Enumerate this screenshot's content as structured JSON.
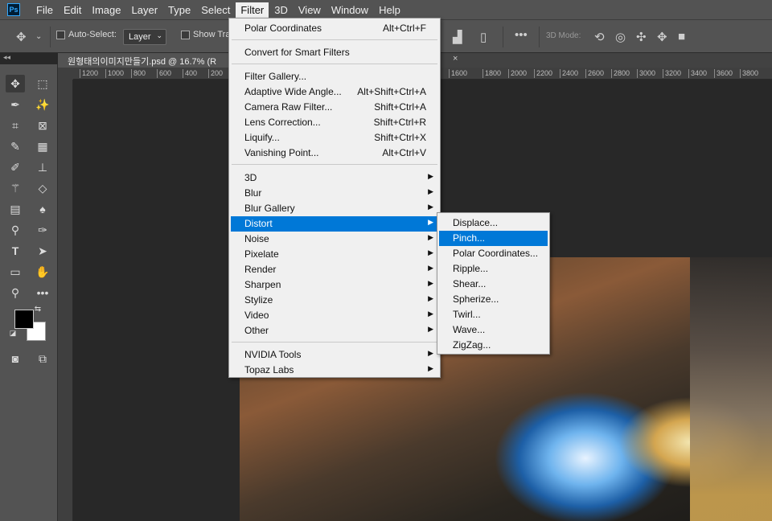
{
  "app": {
    "logo_text": "Ps"
  },
  "menubar": {
    "items": [
      "File",
      "Edit",
      "Image",
      "Layer",
      "Type",
      "Select",
      "Filter",
      "3D",
      "View",
      "Window",
      "Help"
    ],
    "active": "Filter"
  },
  "options_bar": {
    "auto_select_label": "Auto-Select:",
    "auto_select_value": "Layer",
    "show_transform_label": "Show Tra",
    "mode_3d_label": "3D Mode:"
  },
  "document": {
    "tab_title": "원형태의이미지만들기.psd @ 16.7% (R",
    "close_symbol": "×"
  },
  "ruler": {
    "left_ticks": [
      "1200",
      "1000",
      "800",
      "600",
      "400",
      "200"
    ],
    "right_ticks": [
      "1600",
      "1800",
      "2000",
      "2200",
      "2400",
      "2600",
      "2800",
      "3000",
      "3200",
      "3400",
      "3600",
      "3800"
    ]
  },
  "filter_menu": {
    "last_filter": {
      "label": "Polar Coordinates",
      "shortcut": "Alt+Ctrl+F"
    },
    "convert": "Convert for Smart Filters",
    "group1": [
      {
        "label": "Filter Gallery...",
        "shortcut": ""
      },
      {
        "label": "Adaptive Wide Angle...",
        "shortcut": "Alt+Shift+Ctrl+A"
      },
      {
        "label": "Camera Raw Filter...",
        "shortcut": "Shift+Ctrl+A"
      },
      {
        "label": "Lens Correction...",
        "shortcut": "Shift+Ctrl+R"
      },
      {
        "label": "Liquify...",
        "shortcut": "Shift+Ctrl+X"
      },
      {
        "label": "Vanishing Point...",
        "shortcut": "Alt+Ctrl+V"
      }
    ],
    "group2": [
      "3D",
      "Blur",
      "Blur Gallery",
      "Distort",
      "Noise",
      "Pixelate",
      "Render",
      "Sharpen",
      "Stylize",
      "Video",
      "Other"
    ],
    "group3": [
      "NVIDIA Tools",
      "Topaz Labs"
    ],
    "highlighted": "Distort"
  },
  "distort_submenu": {
    "items": [
      "Displace...",
      "Pinch...",
      "Polar Coordinates...",
      "Ripple...",
      "Shear...",
      "Spherize...",
      "Twirl...",
      "Wave...",
      "ZigZag..."
    ],
    "highlighted": "Pinch..."
  },
  "colors": {
    "highlight": "#0078d7",
    "foreground": "#000000",
    "background": "#ffffff"
  }
}
